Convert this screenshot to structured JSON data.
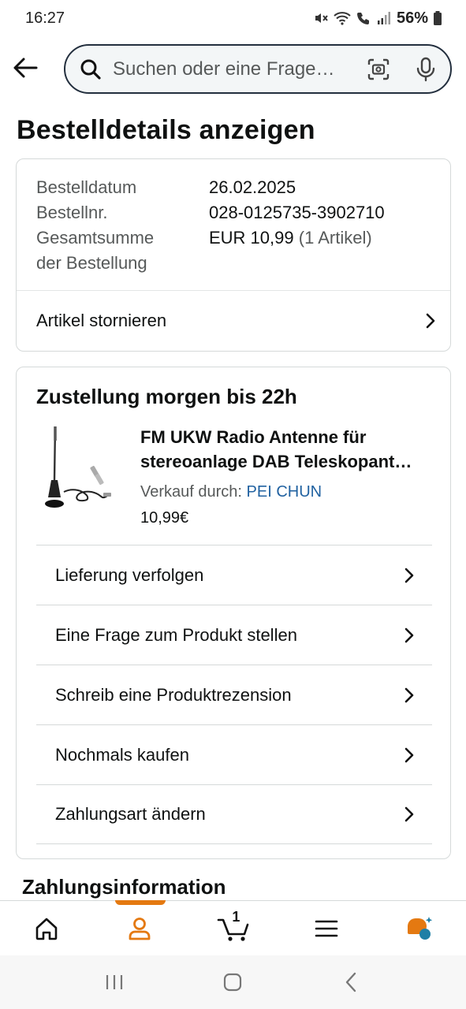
{
  "status_bar": {
    "time": "16:27",
    "battery": "56%"
  },
  "search": {
    "placeholder": "Suchen oder eine Frage…"
  },
  "page_title": "Bestelldetails anzeigen",
  "summary": {
    "order_date_label": "Bestelldatum",
    "order_date": "26.02.2025",
    "order_number_label": "Bestellnr.",
    "order_number": "028-0125735-3902710",
    "total_label_line1": "Gesamtsumme",
    "total_label_line2": "der Bestellung",
    "total_value": "EUR 10,99",
    "total_items": "(1 Artikel)",
    "cancel_label": "Artikel stornieren"
  },
  "delivery": {
    "title": "Zustellung morgen bis 22h",
    "product": {
      "title_line1": "FM UKW Radio Antenne für",
      "title_line2": "stereoanlage DAB Teleskopant…",
      "seller_prefix": "Verkauf durch:",
      "seller_name": "PEI CHUN",
      "price": "10,99€"
    },
    "actions": [
      {
        "label": "Lieferung verfolgen"
      },
      {
        "label": "Eine Frage zum Produkt stellen"
      },
      {
        "label": "Schreib eine Produktrezension"
      },
      {
        "label": "Nochmals kaufen"
      },
      {
        "label": "Zahlungsart ändern"
      }
    ]
  },
  "payment_section_title": "Zahlungsinformation",
  "bottom_nav": {
    "cart_count": "1",
    "accent_color": "#e47911"
  }
}
